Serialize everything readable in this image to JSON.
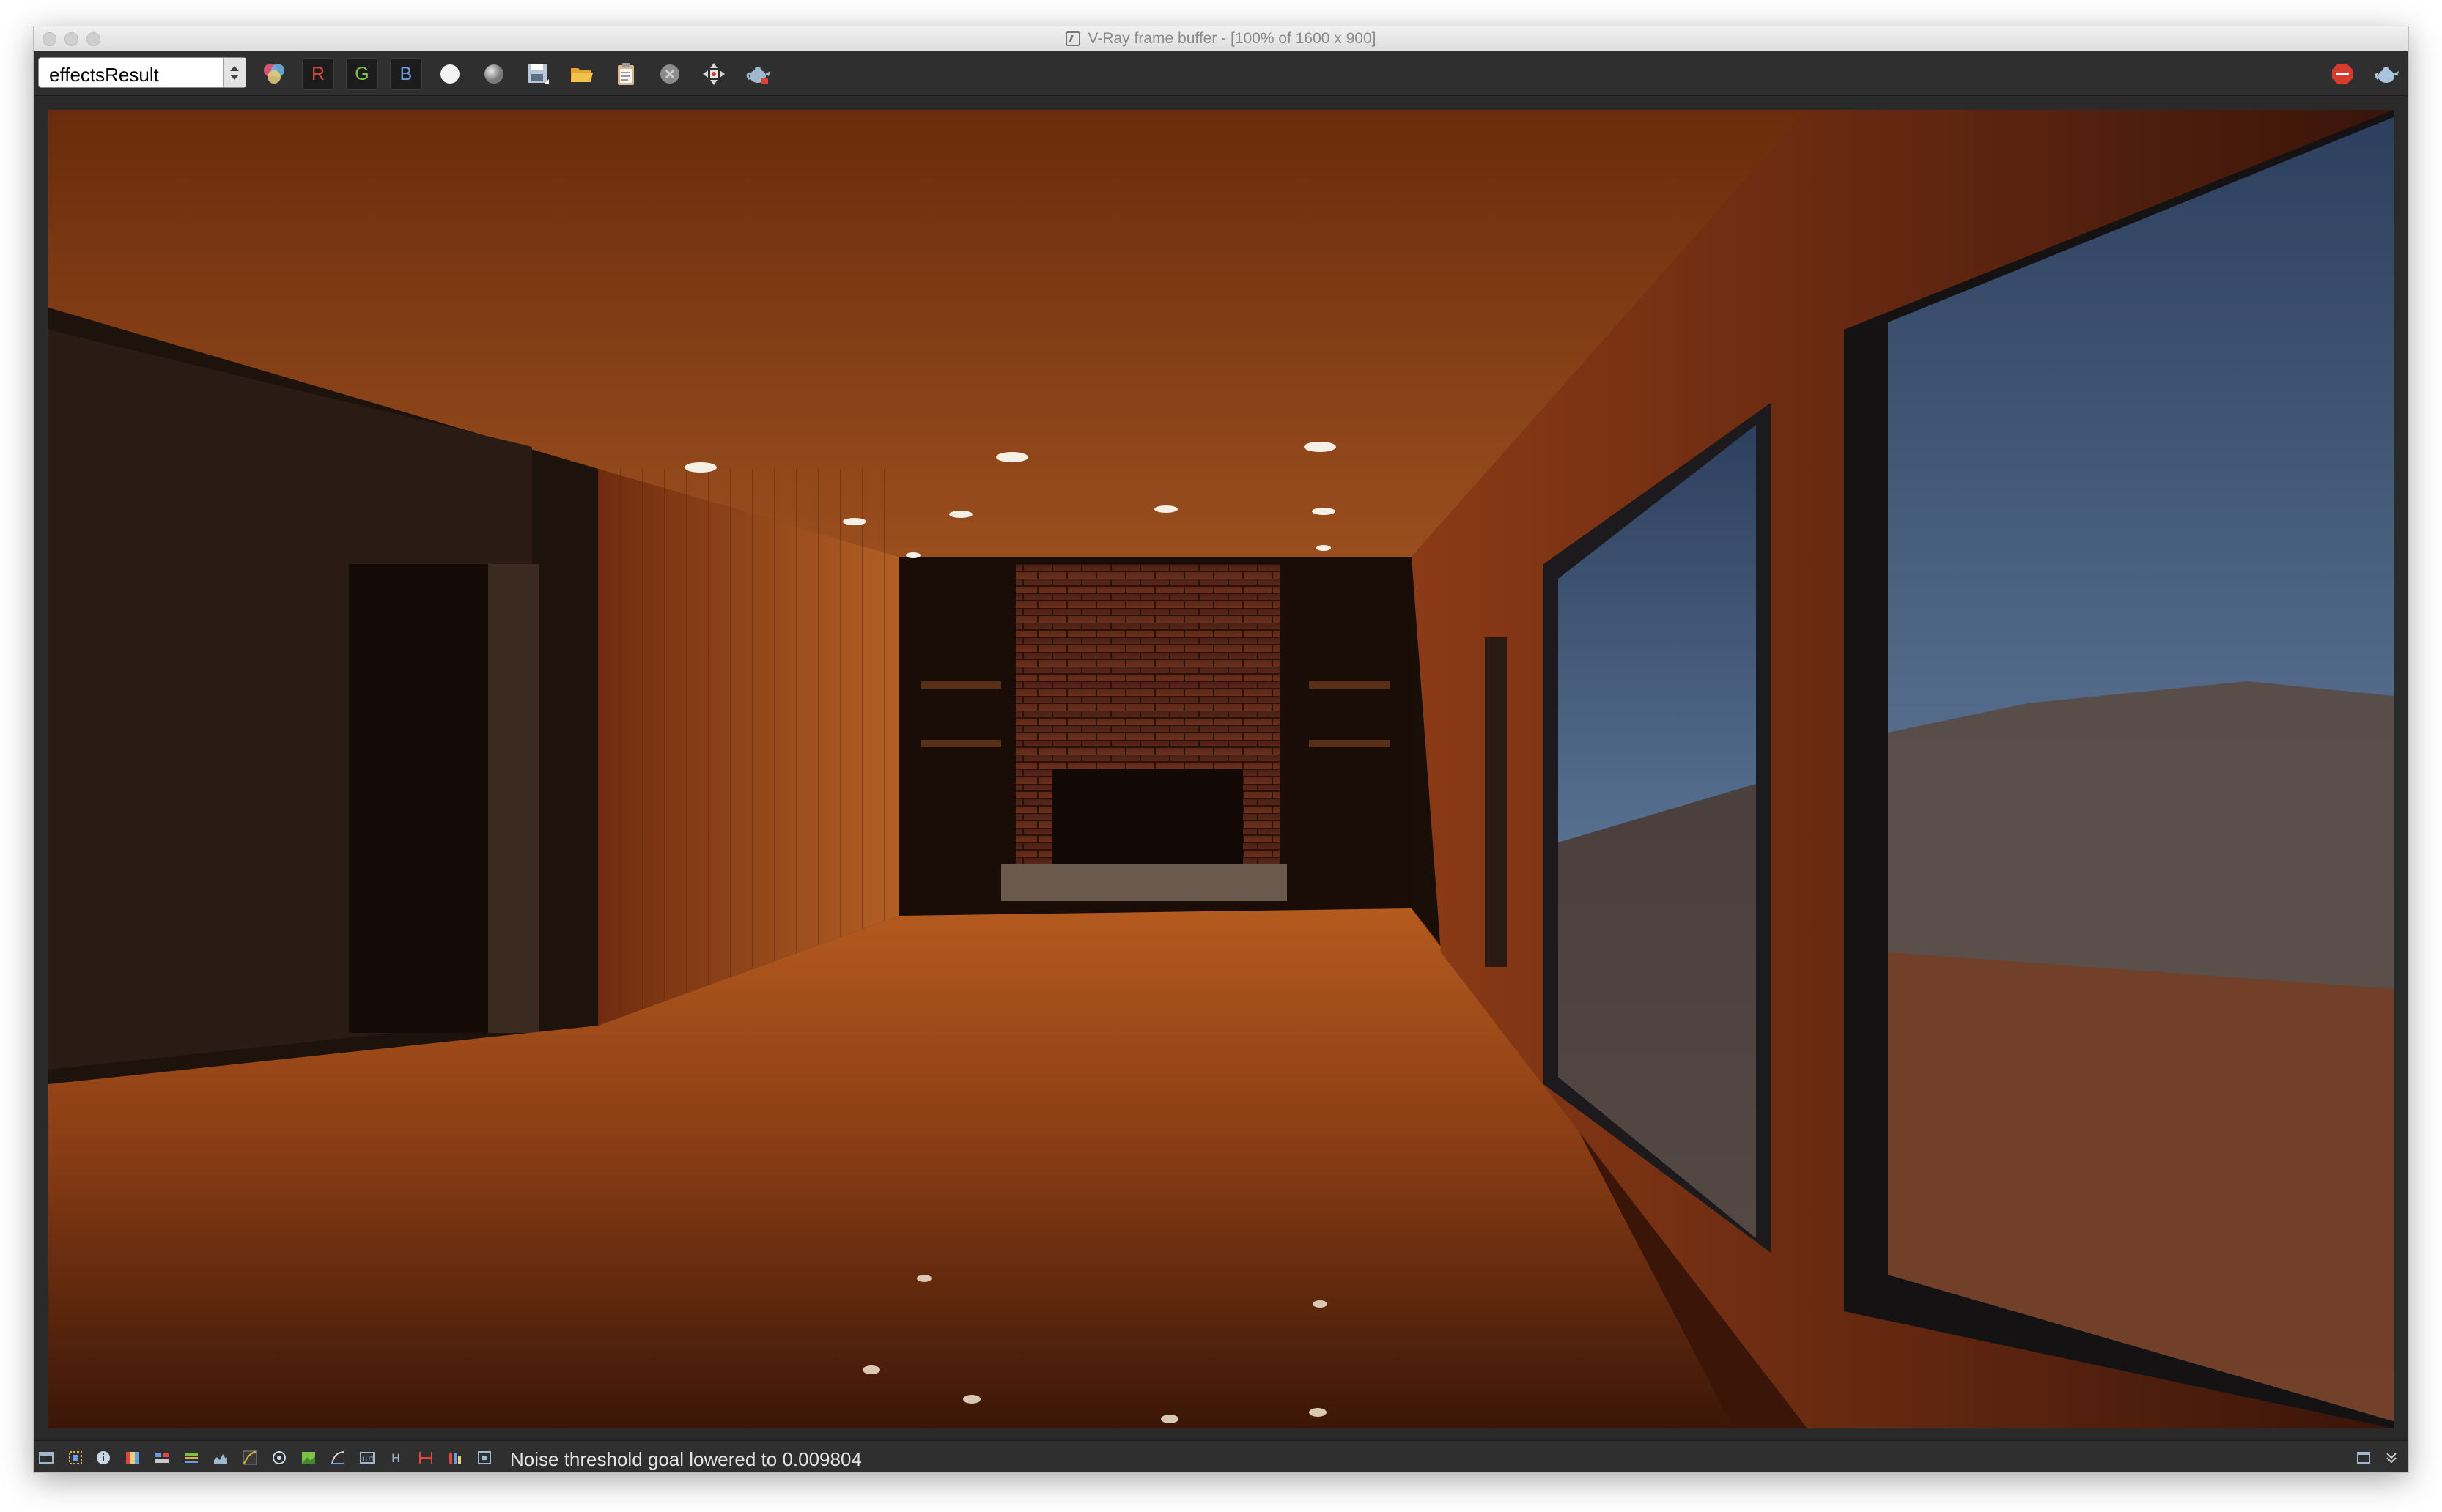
{
  "window": {
    "title": "V-Ray frame buffer - [100% of 1600 x 900]"
  },
  "toolbar": {
    "channel_value": "effectsResult",
    "r_label": "R",
    "g_label": "G",
    "b_label": "B"
  },
  "status": {
    "message": "Noise threshold goal lowered to 0.009804"
  },
  "colors": {
    "chrome_bg": "#2f2f2f",
    "red_channel": "#e0463c",
    "green_channel": "#7cc24a",
    "blue_channel": "#6a9de0",
    "stop_button": "#d83a2e"
  }
}
